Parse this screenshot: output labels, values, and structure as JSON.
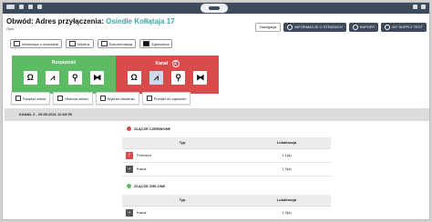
{
  "header": {
    "title_label": "Obwód:",
    "title_main": "Adres przyłączenia:",
    "title_address": "Osiedle Kołłątaja 17",
    "subtitle": "Opis:"
  },
  "header_buttons": [
    {
      "label": "Nawigacja",
      "icon": "none"
    },
    {
      "label": "INFORMACJE O STRATACH",
      "icon": "info-icon"
    },
    {
      "label": "RAPORT",
      "icon": "report-icon"
    },
    {
      "label": "MY SUPPLY TEXT",
      "icon": "settings-icon"
    }
  ],
  "toolbar": [
    {
      "label": "Informacje o obwodzie",
      "icon": "info-card-icon"
    },
    {
      "label": "Wydruk",
      "icon": "print-icon"
    },
    {
      "label": "Dokumentacja",
      "icon": "document-icon"
    },
    {
      "label": "Zgłoszenia",
      "icon": "flag-icon"
    }
  ],
  "panels": {
    "ok": {
      "label": "Rozpiętość",
      "color": "#5dbb63"
    },
    "alarm": {
      "label": "Kanał",
      "count": "2",
      "color": "#d84b4b"
    },
    "icons": [
      "omega-icon",
      "chart-icon",
      "pin-icon",
      "valve-icon"
    ],
    "icon_glyphs": [
      "Ω",
      "⩘",
      "⚲",
      "⧓"
    ]
  },
  "subtools": [
    {
      "label": "Rozpisz ścieki",
      "icon": "list-icon"
    },
    {
      "label": "Historia zmian",
      "icon": "history-icon"
    },
    {
      "label": "Wykres ciśnienia",
      "icon": "graph-icon"
    },
    {
      "label": "Przejdź do zgłoszeń",
      "icon": "window-icon"
    }
  ],
  "event": {
    "label": "KANAŁ 2 - 25.05.2021 12:03:00"
  },
  "sections": [
    {
      "title": "ZŁĄCZE CZERWONE",
      "color": "#d84b4b",
      "columns": [
        "Typ",
        "Lokalizacja"
      ],
      "rows": [
        {
          "type": "Przewód",
          "location": "1.1(a)",
          "icon": "red"
        },
        {
          "type": "Kanał",
          "location": "1.2(a)",
          "icon": "gray"
        }
      ]
    },
    {
      "title": "ZŁĄCZE ZIELONE",
      "color": "#5dbb63",
      "columns": [
        "Typ",
        "Lokalizacja"
      ],
      "rows": [
        {
          "type": "Kanał",
          "location": "1.3(a)",
          "icon": "gray"
        }
      ]
    }
  ]
}
